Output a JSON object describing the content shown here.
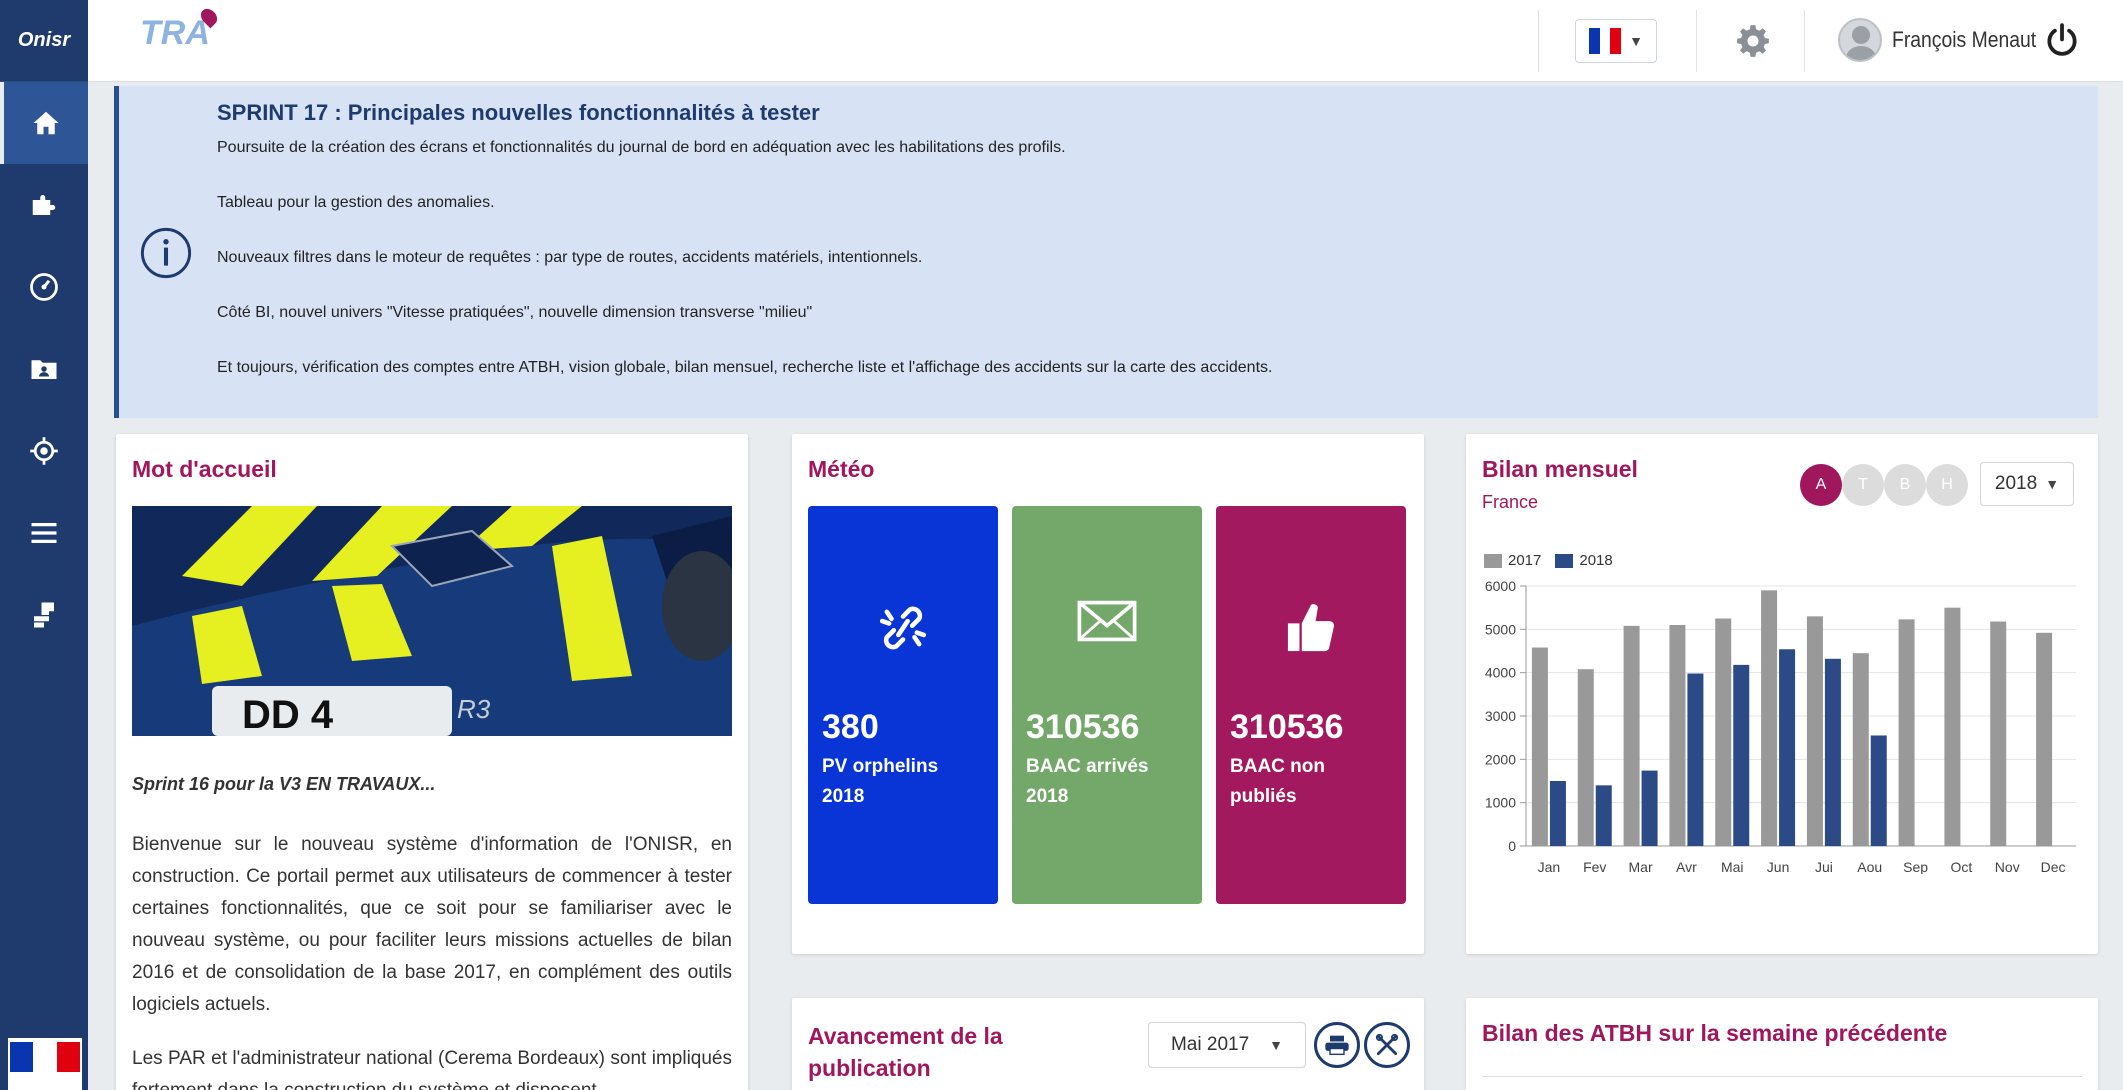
{
  "sidebar": {
    "logo": "Onisr",
    "items": [
      {
        "icon": "home-icon"
      },
      {
        "icon": "puzzle-icon"
      },
      {
        "icon": "speedometer-icon"
      },
      {
        "icon": "folder-user-icon"
      },
      {
        "icon": "target-icon"
      },
      {
        "icon": "menu-icon"
      },
      {
        "icon": "stamp-icon"
      }
    ]
  },
  "topbar": {
    "brand": "TRA",
    "language_flag": "fr-flag-icon",
    "user_name": "François Menaut"
  },
  "banner": {
    "title": "SPRINT 17 : Principales nouvelles fonctionnalités à tester",
    "lines": [
      "Poursuite de la création des écrans et fonctionnalités du journal de bord en adéquation avec les habilitations des profils.",
      "Tableau pour la gestion des anomalies.",
      "Nouveaux filtres dans le moteur de requêtes : par type de routes, accidents matériels, intentionnels.",
      "Côté BI, nouvel univers \"Vitesse pratiquées\", nouvelle dimension transverse \"milieu\"",
      "Et toujours, vérification des comptes entre ATBH, vision globale, bilan mensuel, recherche liste et l'affichage des accidents sur la carte des accidents."
    ]
  },
  "welcome": {
    "title": "Mot d'accueil",
    "subtitle": "Sprint 16 pour la V3 EN TRAVAUX...",
    "paragraphs": [
      "Bienvenue sur le nouveau système d'information de l'ONISR, en construction. Ce portail permet aux utilisateurs de commencer à tester certaines fonctionnalités, que ce soit pour se familiariser avec le nouveau système, ou pour faciliter leurs missions actuelles de bilan 2016 et de consolidation de la base 2017, en complément des outils logiciels actuels.",
      "Les PAR et l'administrateur national (Cerema Bordeaux) sont impliqués fortement dans la construction du système et disposent"
    ]
  },
  "meteo": {
    "title": "Météo",
    "tiles": [
      {
        "value": "380",
        "label_line1": "PV orphelins",
        "label_line2": "2018",
        "color": "#0a35d6",
        "icon": "broken-link-icon"
      },
      {
        "value": "310536",
        "label_line1": "BAAC arrivés",
        "label_line2": "2018",
        "color": "#74a86a",
        "icon": "envelope-icon"
      },
      {
        "value": "310536",
        "label_line1": "BAAC non",
        "label_line2": "publiés",
        "color": "#a3195f",
        "icon": "thumbs-up-icon"
      }
    ]
  },
  "bilan": {
    "title": "Bilan mensuel",
    "subtitle": "France",
    "filters": [
      "A",
      "T",
      "B",
      "H"
    ],
    "year": "2018"
  },
  "chart_data": {
    "type": "bar",
    "categories": [
      "Jan",
      "Fev",
      "Mar",
      "Avr",
      "Mai",
      "Jun",
      "Jui",
      "Aou",
      "Sep",
      "Oct",
      "Nov",
      "Dec"
    ],
    "series": [
      {
        "name": "2017",
        "color": "#999999",
        "values": [
          4580,
          4080,
          5080,
          5100,
          5250,
          5900,
          5300,
          4450,
          5230,
          5500,
          5180,
          4920
        ]
      },
      {
        "name": "2018",
        "color": "#2c4a86",
        "values": [
          1500,
          1400,
          1740,
          3980,
          4180,
          4540,
          4320,
          2550,
          null,
          null,
          null,
          null
        ]
      }
    ],
    "ylim": [
      0,
      6000
    ],
    "yticks": [
      0,
      1000,
      2000,
      3000,
      4000,
      5000,
      6000
    ],
    "grid": true,
    "legend": "top-left"
  },
  "publication": {
    "title_line1": "Avancement de la",
    "title_line2": "publication",
    "month": "Mai 2017"
  },
  "atbh": {
    "title": "Bilan des ATBH sur la semaine précédente"
  }
}
